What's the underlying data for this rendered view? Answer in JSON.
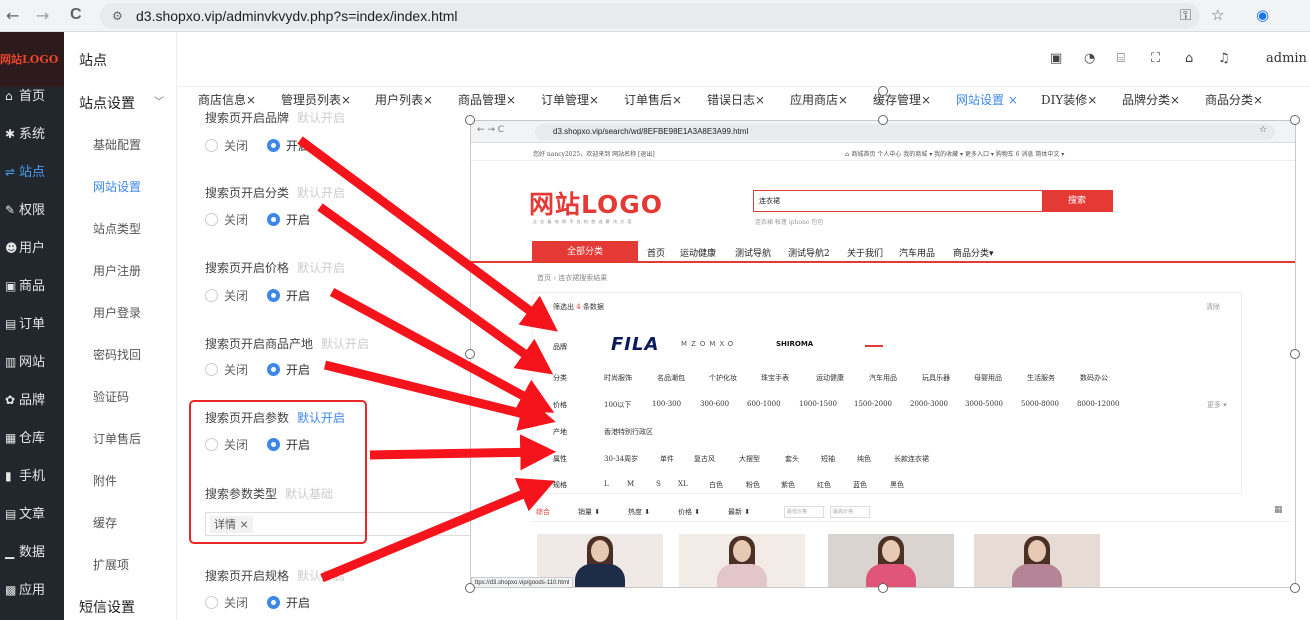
{
  "browser": {
    "url": "d3.shopxo.vip/adminvkvydv.php?s=index/index.html",
    "back": "←",
    "forward": "→",
    "reload": "C",
    "tune_icon": "⚙"
  },
  "sidebar": {
    "logo": "网站LOGO",
    "items": [
      {
        "icon": "⌂",
        "label": "首页"
      },
      {
        "icon": "✱",
        "label": "系统"
      },
      {
        "icon": "⇌",
        "label": "站点"
      },
      {
        "icon": "✎",
        "label": "权限"
      },
      {
        "icon": "☻",
        "label": "用户"
      },
      {
        "icon": "▣",
        "label": "商品"
      },
      {
        "icon": "▤",
        "label": "订单"
      },
      {
        "icon": "▥",
        "label": "网站"
      },
      {
        "icon": "✿",
        "label": "品牌"
      },
      {
        "icon": "▦",
        "label": "仓库"
      },
      {
        "icon": "▮",
        "label": "手机"
      },
      {
        "icon": "▤",
        "label": "文章"
      },
      {
        "icon": "▁",
        "label": "数据"
      },
      {
        "icon": "▩",
        "label": "应用"
      }
    ],
    "active_index": 2
  },
  "submenu": {
    "title": "站点",
    "group": "站点设置",
    "items": [
      "基础配置",
      "网站设置",
      "站点类型",
      "用户注册",
      "用户登录",
      "密码找回",
      "验证码",
      "订单售后",
      "附件",
      "缓存",
      "扩展项"
    ],
    "active_index": 1,
    "group2": "短信设置"
  },
  "header": {
    "admin": "admin"
  },
  "tabs": [
    {
      "label": "商店信息×"
    },
    {
      "label": "管理员列表×"
    },
    {
      "label": "用户列表×"
    },
    {
      "label": "商品管理×"
    },
    {
      "label": "订单管理×"
    },
    {
      "label": "订单售后×"
    },
    {
      "label": "错误日志×"
    },
    {
      "label": "应用商店×"
    },
    {
      "label": "缓存管理×"
    },
    {
      "label": "网站设置 ×"
    },
    {
      "label": "DIY装修×"
    },
    {
      "label": "品牌分类×"
    },
    {
      "label": "商品分类×"
    }
  ],
  "settings": [
    {
      "label": "搜索页开启品牌",
      "hint": "默认开启",
      "off": "关闭",
      "on": "开启"
    },
    {
      "label": "搜索页开启分类",
      "hint": "默认开启",
      "off": "关闭",
      "on": "开启"
    },
    {
      "label": "搜索页开启价格",
      "hint": "默认开启",
      "off": "关闭",
      "on": "开启"
    },
    {
      "label": "搜索页开启商品产地",
      "hint": "默认开启",
      "off": "关闭",
      "on": "开启"
    },
    {
      "label": "搜索页开启参数",
      "hint": "默认开启",
      "off": "关闭",
      "on": "开启"
    },
    {
      "label": "搜索参数类型",
      "hint": "默认基础"
    },
    {
      "label": "搜索页开启规格",
      "hint": "默认开启",
      "off": "关闭",
      "on": "开启"
    }
  ],
  "param_tag": "详情 ×",
  "embed": {
    "url": "d3.shopxo.vip/search/wd/8EFBE98E1A3A8E3A99.html",
    "topbar_left": "您好 nancy2025，欢迎来到 网站名称 [退出]",
    "topbar_right": "⌂ 商城首页   个人中心   我的商城 ▾   我的收藏 ▾   更多入口 ▾   购物车 6   消息   简体中文 ▾",
    "logo": "网站LOGO",
    "slogan": "企 业 级 电 商 平 台 的 首 选 解 决 方 案",
    "search_value": "连衣裙",
    "search_button": "搜索",
    "hot_words": "连衣裙  帐篷  iphone  包包",
    "all_category": "全部分类",
    "nav": [
      "首页",
      "运动健康",
      "测试导航",
      "测试导航2",
      "关于我们",
      "汽车用品",
      "商品分类▾"
    ],
    "breadcrumb": "首页  ›  连衣裙搜索结果",
    "filter_count_pre": "筛选出",
    "filter_count": "4",
    "filter_count_post": "条数据",
    "clear": "清除",
    "rows": {
      "brand": "品牌",
      "category": "分类",
      "price": "价格",
      "origin": "产地",
      "attr": "属性",
      "spec": "规格"
    },
    "brands": [
      "FILA",
      "MZOMXO",
      "SHIROMA"
    ],
    "categories": [
      "时尚服饰",
      "名品潮包",
      "个护化妆",
      "珠宝手表",
      "运动健康",
      "汽车用品",
      "玩具乐器",
      "母婴用品",
      "生活服务",
      "数码办公"
    ],
    "prices": [
      "100以下",
      "100-300",
      "300-600",
      "600-1000",
      "1000-1500",
      "1500-2000",
      "2000-3000",
      "3000-5000",
      "5000-8000",
      "8000-12000"
    ],
    "more": "更多 ▾",
    "origins": [
      "香港特别行政区"
    ],
    "attrs": [
      "30-34周岁",
      "单件",
      "复古风",
      "大摆型",
      "套头",
      "短袖",
      "纯色",
      "长款连衣裙"
    ],
    "specs": [
      "L",
      "M",
      "S",
      "XL",
      "白色",
      "粉色",
      "紫色",
      "红色",
      "蓝色",
      "黑色"
    ],
    "sort": [
      "综合",
      "销量 ⬇",
      "热度 ⬇",
      "价格 ⬇",
      "最新 ⬇"
    ],
    "price_min": "最低价格",
    "price_max": "最高价格",
    "status": "ttps://d3.shopxo.vip/goods-110.html"
  },
  "colors": {
    "accent": "#3c87e8",
    "red": "#e53935",
    "arrow": "#f5141b",
    "sidebar": "#22272e"
  }
}
